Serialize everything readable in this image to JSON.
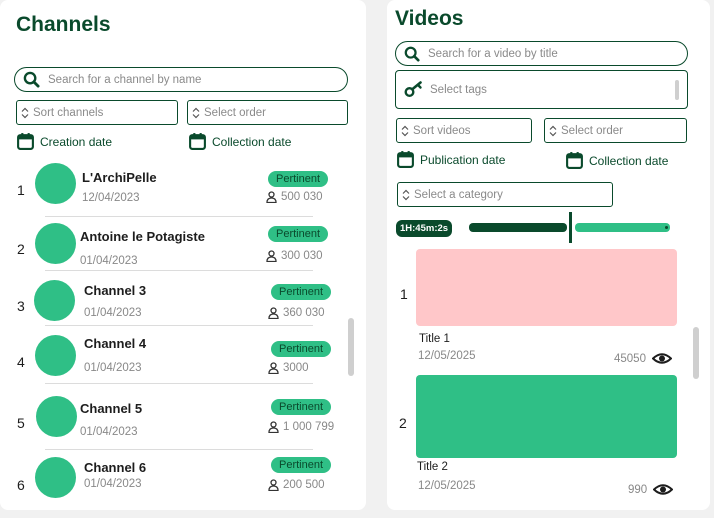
{
  "colors": {
    "dark_green": "#0a4a2c",
    "accent_green": "#2fbf86",
    "pink": "#ffc7c9"
  },
  "channels": {
    "title": "Channels",
    "search_placeholder": "Search for a channel by name",
    "sort_placeholder": "Sort channels",
    "order_placeholder": "Select order",
    "date_buttons": [
      "Creation date",
      "Collection date"
    ],
    "items": [
      {
        "rank": "1",
        "name": "L'ArchiPelle",
        "date": "12/04/2023",
        "badge": "Pertinent",
        "subscribers": "500 030"
      },
      {
        "rank": "2",
        "name": "Antoine le Potagiste",
        "date": "01/04/2023",
        "badge": "Pertinent",
        "subscribers": "300 030"
      },
      {
        "rank": "3",
        "name": "Channel 3",
        "date": "01/04/2023",
        "badge": "Pertinent",
        "subscribers": "360 030"
      },
      {
        "rank": "4",
        "name": "Channel 4",
        "date": "01/04/2023",
        "badge": "Pertinent",
        "subscribers": "3000"
      },
      {
        "rank": "5",
        "name": "Channel 5",
        "date": "01/04/2023",
        "badge": "Pertinent",
        "subscribers": "1 000 799"
      },
      {
        "rank": "6",
        "name": "Channel 6",
        "date": "01/04/2023",
        "badge": "Pertinent",
        "subscribers": "200 500"
      }
    ]
  },
  "videos": {
    "title": "Videos",
    "search_placeholder": "Search for a video by title",
    "tags_placeholder": "Select tags",
    "sort_placeholder": "Sort videos",
    "order_placeholder": "Select order",
    "date_buttons": [
      "Publication date",
      "Collection date"
    ],
    "category_placeholder": "Select a category",
    "duration_label": "1H:45m:2s",
    "duration_slider_position": 0.5,
    "items": [
      {
        "rank": "1",
        "title": "Title 1",
        "date": "12/05/2025",
        "views": "45050",
        "thumb_color": "#ffc7c9"
      },
      {
        "rank": "2",
        "title": "Title 2",
        "date": "12/05/2025",
        "views": "990",
        "thumb_color": "#2fbf86"
      }
    ]
  }
}
